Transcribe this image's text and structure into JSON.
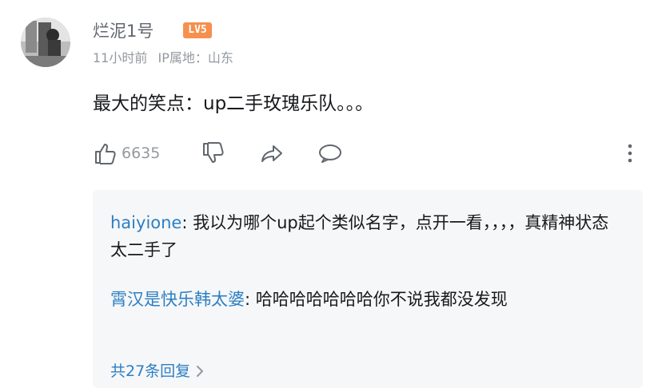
{
  "comment": {
    "author": "烂泥1号",
    "level_badge": "LV5",
    "time": "11小时前",
    "ip_location": "IP属地：山东",
    "text": "最大的笑点：up二手玫瑰乐队。。。",
    "like_count": "6635"
  },
  "icons": {
    "like": "thumbs-up-icon",
    "dislike": "thumbs-down-icon",
    "share": "share-arrow-icon",
    "reply": "comment-bubble-icon",
    "more": "more-vertical-icon",
    "chevron": "chevron-right-icon"
  },
  "replies": [
    {
      "name": "haiyione",
      "text": "我以为哪个up起个类似名字，点开一看，，，，真精神状态太二手了"
    },
    {
      "name": "霄汉是快乐韩太婆",
      "text": "哈哈哈哈哈哈哈你不说我都没发现"
    }
  ],
  "reply_total_label": "共27条回复",
  "colors": {
    "link_blue": "#2c7fc4",
    "level_orange": "#f5904e",
    "meta_gray": "#9499a0",
    "reply_bg": "#f6f7f8"
  }
}
